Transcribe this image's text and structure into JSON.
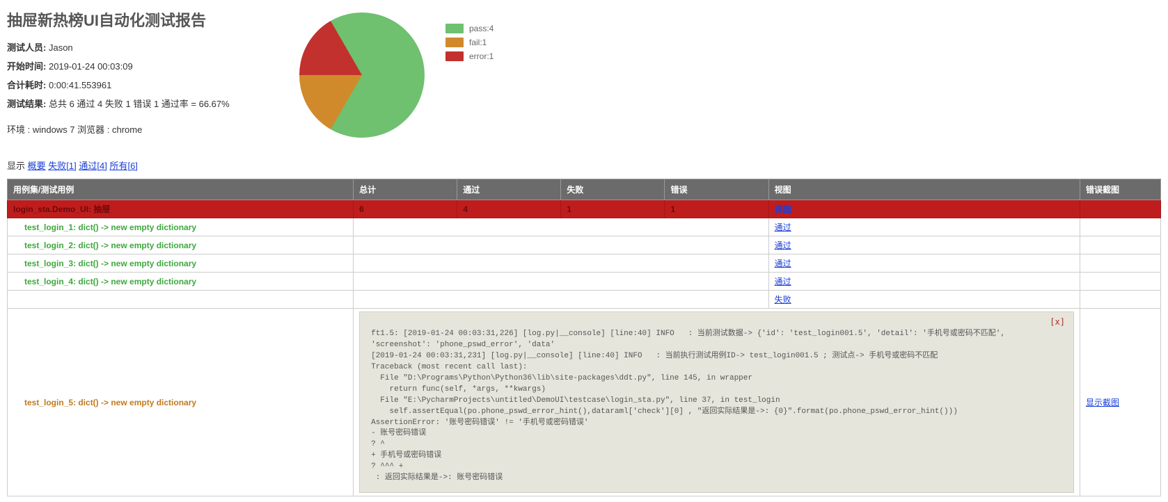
{
  "title": "抽屉新热榜UI自动化测试报告",
  "meta": {
    "tester_label": "测试人员:",
    "tester": "Jason",
    "start_label": "开始时间:",
    "start": "2019-01-24 00:03:09",
    "duration_label": "合计耗时:",
    "duration": "0:00:41.553961",
    "result_label": "测试结果:",
    "result": "总共 6 通过 4 失败 1 错误 1 通过率 = 66.67%",
    "env": "环境 : windows 7 浏览器 : chrome"
  },
  "chart_data": {
    "type": "pie",
    "title": "",
    "slices": [
      {
        "name": "pass",
        "value": 4,
        "color": "#6fc06f"
      },
      {
        "name": "fail",
        "value": 1,
        "color": "#d08a2c"
      },
      {
        "name": "error",
        "value": 1,
        "color": "#c2312d"
      }
    ]
  },
  "legend": {
    "pass": {
      "label": "pass:4",
      "color": "#6fc06f"
    },
    "fail": {
      "label": "fail:1",
      "color": "#d08a2c"
    },
    "error": {
      "label": "error:1",
      "color": "#c2312d"
    }
  },
  "filters": {
    "prefix": "显示",
    "summary": "概要",
    "fail": "失败[1]",
    "pass": "通过[4]",
    "all": "所有[6]"
  },
  "table": {
    "headers": {
      "name": "用例集/测试用例",
      "total": "总计",
      "pass": "通过",
      "fail": "失败",
      "error": "错误",
      "view": "视图",
      "shot": "错误截图"
    },
    "suite": {
      "name": "login_sta.Demo_UI: 抽屉",
      "total": "6",
      "pass": "4",
      "fail": "1",
      "error": "1",
      "view": "详细"
    },
    "rows": [
      {
        "name": "test_login_1: dict() -> new empty dictionary",
        "result": "通过"
      },
      {
        "name": "test_login_2: dict() -> new empty dictionary",
        "result": "通过"
      },
      {
        "name": "test_login_3: dict() -> new empty dictionary",
        "result": "通过"
      },
      {
        "name": "test_login_4: dict() -> new empty dictionary",
        "result": "通过"
      }
    ],
    "fail_head_result": "失败",
    "fail_case": {
      "name": "test_login_5: dict() -> new empty dictionary",
      "close": "[x]",
      "trace": "ft1.5: [2019-01-24 00:03:31,226] [log.py|__console] [line:40] INFO   : 当前测试数据-> {'id': 'test_login001.5', 'detail': '手机号或密码不匹配', 'screenshot': 'phone_pswd_error', 'data'\n[2019-01-24 00:03:31,231] [log.py|__console] [line:40] INFO   : 当前执行测试用例ID-> test_login001.5 ; 测试点-> 手机号或密码不匹配\nTraceback (most recent call last):\n  File \"D:\\Programs\\Python\\Python36\\lib\\site-packages\\ddt.py\", line 145, in wrapper\n    return func(self, *args, **kwargs)\n  File \"E:\\PycharmProjects\\untitled\\DemoUI\\testcase\\login_sta.py\", line 37, in test_login\n    self.assertEqual(po.phone_pswd_error_hint(),dataraml['check'][0] , \"返回实际结果是->: {0}\".format(po.phone_pswd_error_hint()))\nAssertionError: '账号密码错误' != '手机号或密码错误'\n- 账号密码错误\n? ^\n+ 手机号或密码错误\n? ^^^ +\n : 返回实际结果是->: 账号密码错误",
      "shot": "显示截图"
    }
  }
}
